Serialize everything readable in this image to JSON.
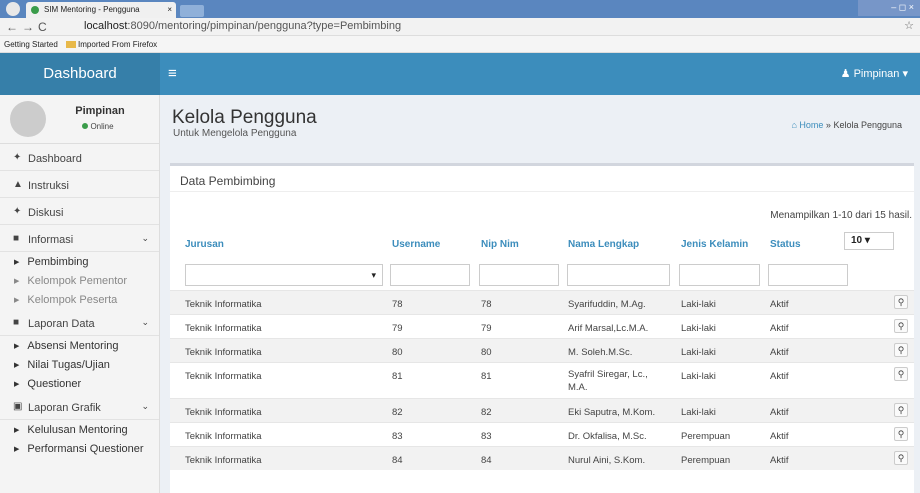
{
  "browser": {
    "tab_title": "SIM Mentoring - Pengguna",
    "tab_close": "×",
    "url_host": "localhost",
    "url_rest": ":8090/mentoring/pimpinan/pengguna?type=Pembimbing",
    "window_controls": "– ◻ ×",
    "bookmarks": [
      "Getting Started",
      "Imported From Firefox"
    ]
  },
  "header": {
    "logo": "Dashboard",
    "menu_icon": "≡",
    "user_label": "Pimpinan ▾"
  },
  "sidebar": {
    "user_name": "Pimpinan",
    "user_status": "Online",
    "items": [
      {
        "icon": "✦",
        "label": "Dashboard"
      },
      {
        "icon": "▲",
        "label": "Instruksi"
      },
      {
        "icon": "✦",
        "label": "Diskusi"
      },
      {
        "icon": "■",
        "label": "Informasi",
        "caret": "⌄"
      },
      {
        "icon": "■",
        "label": "Laporan Data",
        "caret": "⌄"
      },
      {
        "icon": "▣",
        "label": "Laporan Grafik",
        "caret": "⌄"
      }
    ],
    "informasi_sub": [
      "Pembimbing",
      "Kelompok Pementor",
      "Kelompok Peserta"
    ],
    "laporan_data_sub": [
      "Absensi Mentoring",
      "Nilai Tugas/Ujian",
      "Questioner"
    ],
    "laporan_grafik_sub": [
      "Kelulusan Mentoring",
      "Performansi Questioner"
    ]
  },
  "page": {
    "title": "Kelola Pengguna",
    "subtitle": "Untuk Mengelola Pengguna",
    "breadcrumb_home": "⌂ Home",
    "breadcrumb_sep": "»",
    "breadcrumb_current": "Kelola Pengguna"
  },
  "box": {
    "title": "Data Pembimbing",
    "summary": "Menampilkan 1-10 dari 15 hasil.",
    "page_size": "10  ▾",
    "filter_dropdown": "▾"
  },
  "table": {
    "headers": [
      "Jurusan",
      "Username",
      "Nip Nim",
      "Nama Lengkap",
      "Jenis Kelamin",
      "Status"
    ],
    "view_icon": "⚲",
    "rows": [
      [
        "Teknik Informatika",
        "78",
        "78",
        "Syarifuddin, M.Ag.",
        "Laki-laki",
        "Aktif"
      ],
      [
        "Teknik Informatika",
        "79",
        "79",
        "Arif Marsal,Lc.M.A.",
        "Laki-laki",
        "Aktif"
      ],
      [
        "Teknik Informatika",
        "80",
        "80",
        "M. Soleh.M.Sc.",
        "Laki-laki",
        "Aktif"
      ],
      [
        "Teknik Informatika",
        "81",
        "81",
        "Syafril Siregar, Lc., M.A.",
        "Laki-laki",
        "Aktif"
      ],
      [
        "Teknik Informatika",
        "82",
        "82",
        "Eki Saputra, M.Kom.",
        "Laki-laki",
        "Aktif"
      ],
      [
        "Teknik Informatika",
        "83",
        "83",
        "Dr. Okfalisa, M.Sc.",
        "Perempuan",
        "Aktif"
      ],
      [
        "Teknik Informatika",
        "84",
        "84",
        "Nurul Aini, S.Kom.",
        "Perempuan",
        "Aktif"
      ]
    ]
  }
}
